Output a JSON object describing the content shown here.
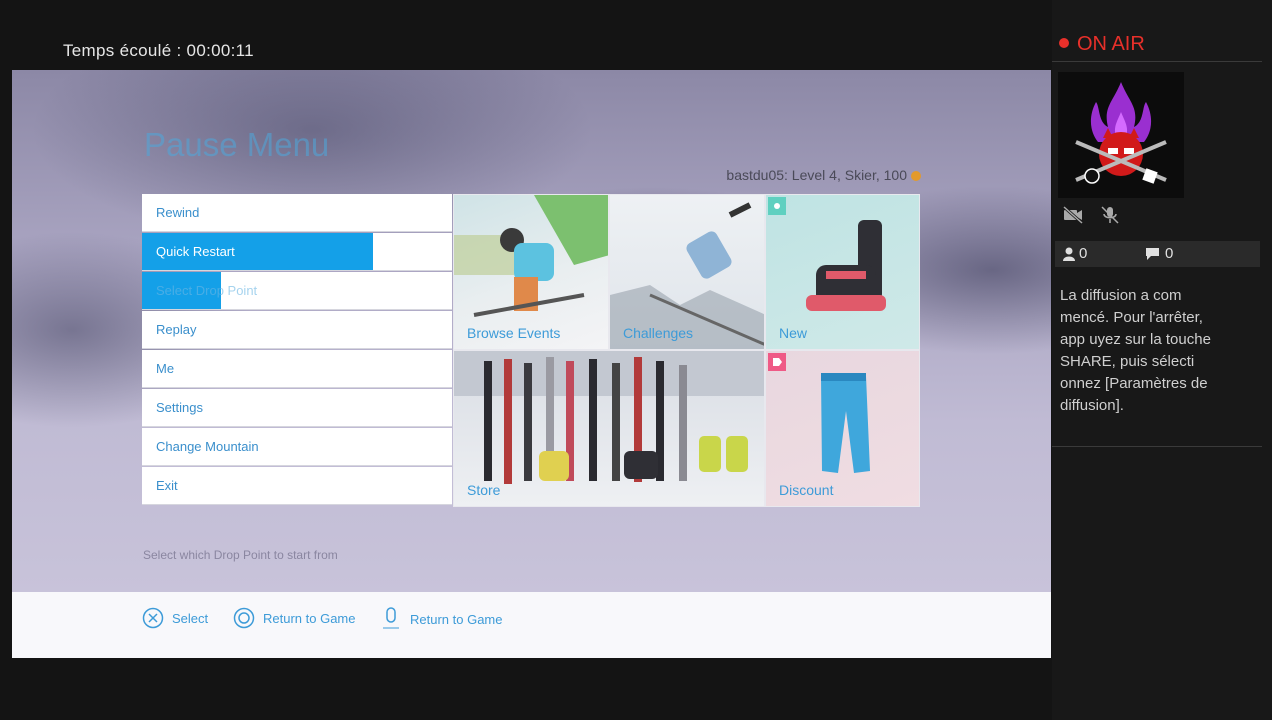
{
  "overlay": {
    "elapsed_label": "Temps écoulé : 00:00:11"
  },
  "game": {
    "title": "Pause Menu",
    "player_info": "bastdu05: Level 4, Skier, 100",
    "menu": [
      "Rewind",
      "Quick Restart",
      "Select Drop Point",
      "Replay",
      "Me",
      "Settings",
      "Change Mountain",
      "Exit"
    ],
    "tiles": {
      "browse_events": "Browse Events",
      "challenges": "Challenges",
      "new": "New",
      "store": "Store",
      "discount": "Discount"
    },
    "hint": "Select which Drop Point to start from",
    "footer": {
      "select": "Select",
      "return_circle": "Return to Game",
      "return_options": "Return to Game"
    },
    "colors": {
      "accent": "#14a0e8",
      "text_blue": "#3d9bd8",
      "onair_red": "#e8302a"
    }
  },
  "stream": {
    "on_air": "ON AIR",
    "viewers": "0",
    "comments": "0",
    "message": "La diffusion a com mencé. Pour l'arrêter, app uyez sur la touche SHARE, puis sélecti onnez [Paramètres de diffusion]."
  }
}
